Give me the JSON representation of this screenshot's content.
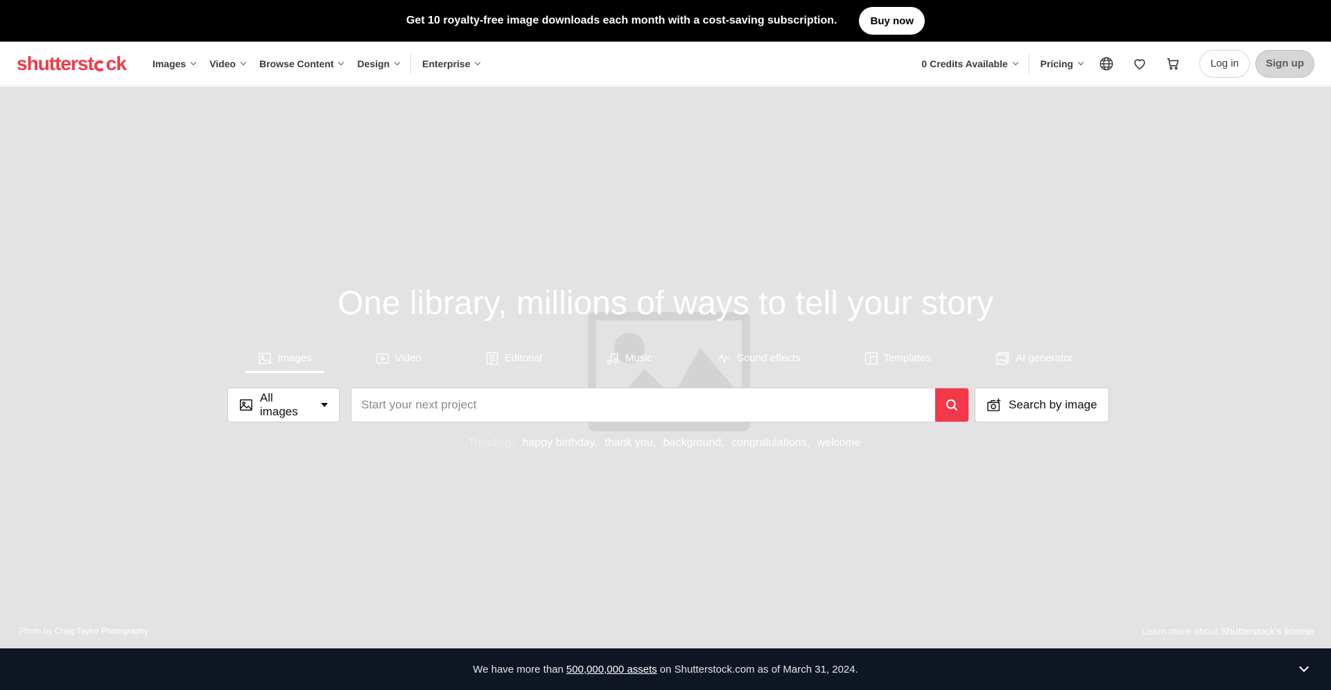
{
  "promo": {
    "text": "Get 10 royalty-free image downloads each month with a cost-saving subscription.",
    "button": "Buy now"
  },
  "nav": {
    "logo_pre": "shutterst",
    "logo_post": "ck",
    "items": [
      "Images",
      "Video",
      "Browse Content",
      "Design",
      "Enterprise"
    ],
    "credits": "0 Credits Available",
    "pricing": "Pricing",
    "icons": [
      "globe-icon",
      "heart-icon",
      "cart-icon"
    ],
    "login": "Log in",
    "signup": "Sign up"
  },
  "hero": {
    "title": "One library, millions of ways to tell your story",
    "tabs": [
      {
        "label": "Images",
        "icon": "image-icon",
        "active": true
      },
      {
        "label": "Video",
        "icon": "video-icon",
        "active": false
      },
      {
        "label": "Editorial",
        "icon": "editorial-icon",
        "active": false
      },
      {
        "label": "Music",
        "icon": "music-icon",
        "active": false
      },
      {
        "label": "Sound effects",
        "icon": "soundwave-icon",
        "active": false
      },
      {
        "label": "Templates",
        "icon": "template-icon",
        "active": false
      },
      {
        "label": "AI generator",
        "icon": "ai-generator-icon",
        "active": false
      }
    ],
    "type_select": "All images",
    "search_placeholder": "Start your next project",
    "search_by_image": "Search by image",
    "trending_label": "Trending:",
    "trending": [
      "happy birthday,",
      "thank you,",
      "background,",
      "congratulations,",
      "welcome"
    ],
    "credit_prefix": "Photo",
    "credit_by": "by",
    "credit_name": "Craig Taylor Photography",
    "license_prefix": "Learn more about",
    "license_link": "Shutterstock's license"
  },
  "footer": {
    "text_pre": "We have more than",
    "link": "500,000,000 assets",
    "text_post": "on Shutterstock.com as of March 31, 2024."
  },
  "colors": {
    "accent": "#f23849",
    "promo_bg": "#000000",
    "hero_bg": "#e3e3e3",
    "footer_bg": "#0e1624"
  }
}
